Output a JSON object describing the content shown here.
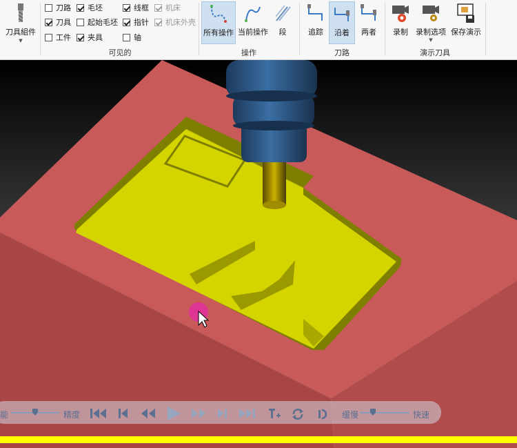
{
  "ribbon": {
    "tool_assembly": {
      "label": "刀具組件"
    },
    "visible_group": {
      "title": "可见的",
      "checkboxes": [
        {
          "label": "刀路",
          "checked": false,
          "enabled": true
        },
        {
          "label": "毛坯",
          "checked": true,
          "enabled": true
        },
        {
          "label": "线框",
          "checked": true,
          "enabled": true
        },
        {
          "label": "机床",
          "checked": true,
          "enabled": false
        },
        {
          "label": "刀具",
          "checked": true,
          "enabled": true
        },
        {
          "label": "起始毛坯",
          "checked": false,
          "enabled": true
        },
        {
          "label": "指针",
          "checked": true,
          "enabled": true
        },
        {
          "label": "机床外壳",
          "checked": true,
          "enabled": false
        },
        {
          "label": "工件",
          "checked": false,
          "enabled": true
        },
        {
          "label": "夹具",
          "checked": true,
          "enabled": true
        },
        {
          "label": "轴",
          "checked": false,
          "enabled": true
        }
      ]
    },
    "operation_group": {
      "title": "操作",
      "buttons": [
        {
          "label": "所有操作",
          "active": true
        },
        {
          "label": "当前操作",
          "active": false
        },
        {
          "label": "段",
          "active": false
        }
      ]
    },
    "toolpath_group": {
      "title": "刀路",
      "buttons": [
        {
          "label": "追踪",
          "active": false
        },
        {
          "label": "沿着",
          "active": true
        },
        {
          "label": "两者",
          "active": false
        }
      ]
    },
    "demo_group": {
      "title": "演示刀具",
      "buttons": [
        {
          "label": "录制"
        },
        {
          "label": "录制选项"
        },
        {
          "label": "保存演示"
        }
      ]
    }
  },
  "playback": {
    "left_label": "能",
    "precision_label": "精度",
    "slow_label": "缓慢",
    "fast_label": "快速",
    "precision_level": 0.5,
    "speed_level": 0.33
  },
  "colors": {
    "stock": "#c95a5a",
    "machined": "#d4d400",
    "tool": "#2f5a8a",
    "status_line": "#ffff00",
    "cursor_highlight": "#e0309a"
  }
}
